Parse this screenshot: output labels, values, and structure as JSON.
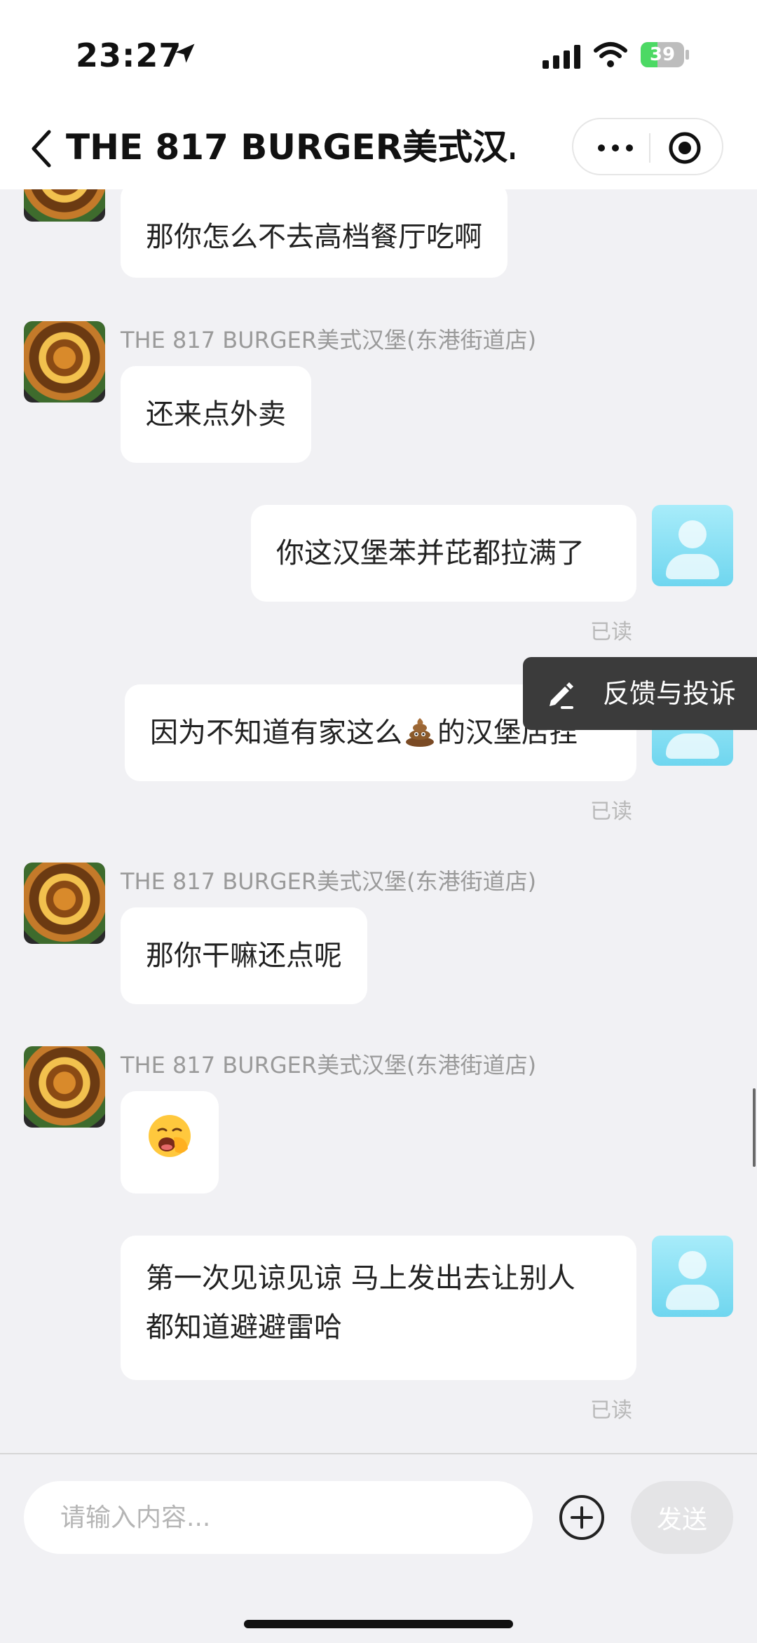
{
  "status_bar": {
    "time": "23:27",
    "battery_percent": 39,
    "battery_text": "39",
    "icons": [
      "location-arrow-icon",
      "signal-icon",
      "wifi-icon",
      "battery-icon"
    ]
  },
  "nav": {
    "title": "THE 817 BURGER美式汉…",
    "icons": [
      "back-icon",
      "more-icon",
      "record-icon"
    ]
  },
  "messages": [
    {
      "side": "left",
      "text": "那你怎么不去高档餐厅吃啊"
    },
    {
      "side": "left",
      "sender": "THE 817 BURGER美式汉堡(东港街道店)",
      "text": "还来点外卖"
    },
    {
      "side": "right",
      "text": "你这汉堡苯并芘都拉满了",
      "status": "已读"
    },
    {
      "side": "right",
      "text_before": "因为不知道有家这么",
      "emoji": "pile-of-poo-icon",
      "text_after": "的汉堡店捏",
      "status": "已读"
    },
    {
      "side": "left",
      "sender": "THE 817 BURGER美式汉堡(东港街道店)",
      "text": "那你干嘛还点呢"
    },
    {
      "side": "left",
      "sender": "THE 817 BURGER美式汉堡(东港街道店)",
      "emoji": "yawning-face-icon"
    },
    {
      "side": "right",
      "lines": [
        "第一次见谅见谅 马上发出去让别人",
        "都知道避避雷哈"
      ],
      "status": "已读"
    }
  ],
  "feedback": {
    "label": "反馈与投诉",
    "icon": "pencil-icon"
  },
  "input": {
    "placeholder": "请输入内容...",
    "value": ""
  },
  "send_label": "发送",
  "colors": {
    "background": "#f1f1f4",
    "bubble": "#ffffff",
    "feedback_bg": "#3b3b3b",
    "battery_green": "#4cd964",
    "send_disabled": "#e4e4e6"
  }
}
